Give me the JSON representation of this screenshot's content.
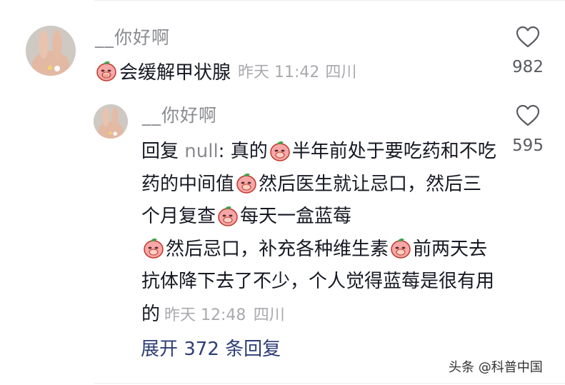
{
  "comment": {
    "username": "__你好啊",
    "emoji": "peach-cover-face-emoji",
    "text": "会缓解甲状腺",
    "timestamp": "昨天 11:42",
    "location": "四川",
    "likes": "982"
  },
  "reply": {
    "username": "__你好啊",
    "prefix": "回复 ",
    "target": "null",
    "segments": [
      ": 真的",
      "半年前处于要吃药和不吃药的中间值",
      "然后医生就让忌口，然后三个月复查",
      "每天一盒蓝莓",
      "然后忌口，补充各种维生素",
      "前两天去抗体降下去了不少，个人觉得蓝莓是很有用的"
    ],
    "timestamp": "昨天 12:48",
    "location": "四川",
    "likes": "595"
  },
  "expand_label": "展开 372 条回复",
  "watermark": "头条 @科普中国",
  "colors": {
    "username": "#8a8b91",
    "meta": "#a9aaae",
    "link": "#2c3e75",
    "text": "#161823"
  }
}
